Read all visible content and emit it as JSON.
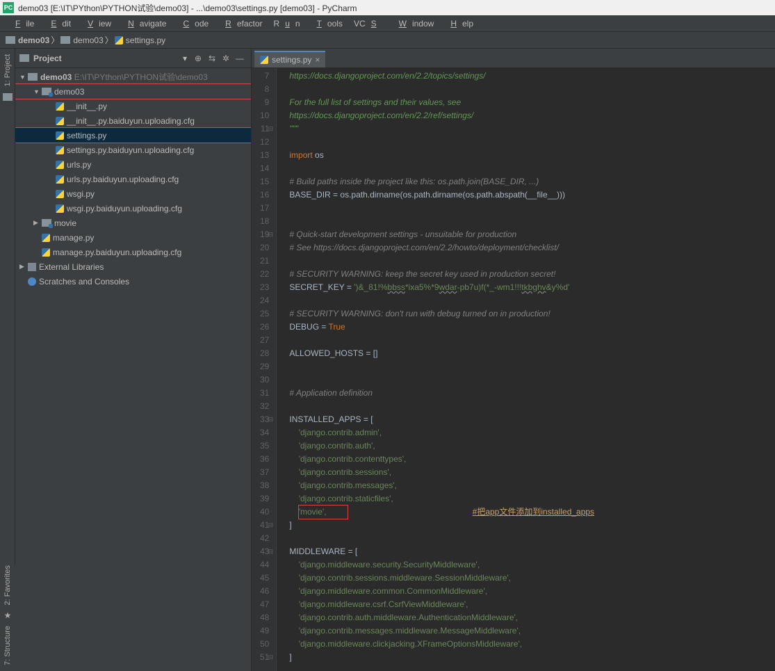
{
  "title": "demo03 [E:\\IT\\PYthon\\PYTHON试验\\demo03] - ...\\demo03\\settings.py [demo03] - PyCharm",
  "menus": [
    "File",
    "Edit",
    "View",
    "Navigate",
    "Code",
    "Refactor",
    "Run",
    "Tools",
    "VCS",
    "Window",
    "Help"
  ],
  "breadcrumbs": {
    "root": "demo03",
    "pkg": "demo03",
    "file": "settings.py"
  },
  "project": {
    "title": "Project",
    "root_name": "demo03",
    "root_path": "E:\\IT\\PYthon\\PYTHON试验\\demo03",
    "pkg_name": "demo03",
    "files": {
      "init": "__init__.py",
      "init_cfg": "__init__.py.baiduyun.uploading.cfg",
      "settings": "settings.py",
      "settings_cfg": "settings.py.baiduyun.uploading.cfg",
      "urls": "urls.py",
      "urls_cfg": "urls.py.baiduyun.uploading.cfg",
      "wsgi": "wsgi.py",
      "wsgi_cfg": "wsgi.py.baiduyun.uploading.cfg"
    },
    "movie_dir": "movie",
    "manage": "manage.py",
    "manage_cfg": "manage.py.baiduyun.uploading.cfg",
    "ext_lib": "External Libraries",
    "scratches": "Scratches and Consoles"
  },
  "tab_name": "settings.py",
  "gutter_start": 7,
  "gutter_end": 51,
  "code": {
    "l7": "https://docs.djangoproject.com/en/2.2/topics/settings/",
    "l9": "For the full list of settings and their values, see",
    "l10": "https://docs.djangoproject.com/en/2.2/ref/settings/",
    "l11": "\"\"\"",
    "l13_kw": "import",
    "l13_v": " os",
    "l15": "# Build paths inside the project like this: os.path.join(BASE_DIR, ...)",
    "l16_a": "BASE_DIR = ",
    "l16_b": "os",
    "l16_c": ".path.dirname(",
    "l16_d": "os",
    "l16_e": ".path.dirname(",
    "l16_f": "os",
    "l16_g": ".path.abspath(__file__)))",
    "l19": "# Quick-start development settings - unsuitable for production",
    "l20": "# See https://docs.djangoproject.com/en/2.2/howto/deployment/checklist/",
    "l22": "# SECURITY WARNING: keep the secret key used in production secret!",
    "l23_a": "SECRET_KEY = ",
    "l23_b": "')&_81!%",
    "l23_c": "bbss",
    "l23_d": "*ixa5%*9",
    "l23_e": "wdar",
    "l23_f": "-pb7u)f(*_-wm1!!!",
    "l23_g": "tkbghv",
    "l23_h": "&y%d'",
    "l25": "# SECURITY WARNING: don't run with debug turned on in production!",
    "l26_a": "DEBUG = ",
    "l26_b": "True",
    "l28": "ALLOWED_HOSTS = []",
    "l31": "# Application definition",
    "l33": "INSTALLED_APPS = [",
    "l34": "'django.contrib.admin',",
    "l35": "'django.contrib.auth',",
    "l36": "'django.contrib.contenttypes',",
    "l37": "'django.contrib.sessions',",
    "l38": "'django.contrib.messages',",
    "l39": "'django.contrib.staticfiles',",
    "l40": "'movie',",
    "l40_anno": "#把app文件添加到installed_apps",
    "l41": "]",
    "l43": "MIDDLEWARE = [",
    "l44": "'django.middleware.security.SecurityMiddleware',",
    "l45": "'django.contrib.sessions.middleware.SessionMiddleware',",
    "l46": "'django.middleware.common.CommonMiddleware',",
    "l47": "'django.middleware.csrf.CsrfViewMiddleware',",
    "l48": "'django.contrib.auth.middleware.AuthenticationMiddleware',",
    "l49": "'django.contrib.messages.middleware.MessageMiddleware',",
    "l50": "'django.middleware.clickjacking.XFrameOptionsMiddleware',",
    "l51": "]"
  },
  "left_tools": {
    "project": "1: Project"
  },
  "bottom_tools": {
    "fav": "2: Favorites",
    "struct": "7: Structure"
  }
}
